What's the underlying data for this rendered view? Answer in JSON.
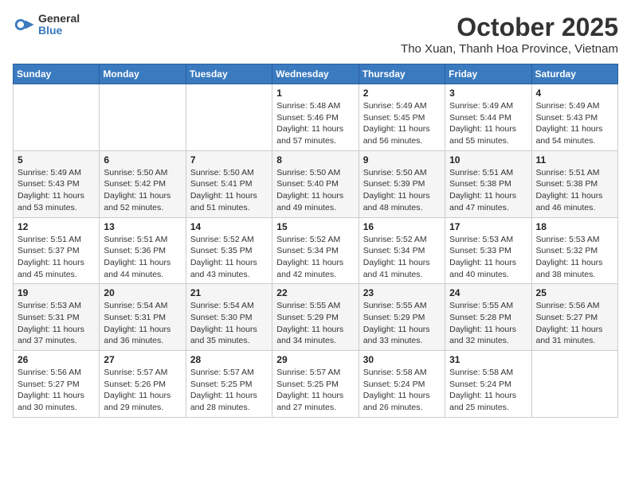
{
  "logo": {
    "general": "General",
    "blue": "Blue"
  },
  "title": "October 2025",
  "location": "Tho Xuan, Thanh Hoa Province, Vietnam",
  "weekdays": [
    "Sunday",
    "Monday",
    "Tuesday",
    "Wednesday",
    "Thursday",
    "Friday",
    "Saturday"
  ],
  "weeks": [
    [
      {
        "day": "",
        "info": ""
      },
      {
        "day": "",
        "info": ""
      },
      {
        "day": "",
        "info": ""
      },
      {
        "day": "1",
        "info": "Sunrise: 5:48 AM\nSunset: 5:46 PM\nDaylight: 11 hours and 57 minutes."
      },
      {
        "day": "2",
        "info": "Sunrise: 5:49 AM\nSunset: 5:45 PM\nDaylight: 11 hours and 56 minutes."
      },
      {
        "day": "3",
        "info": "Sunrise: 5:49 AM\nSunset: 5:44 PM\nDaylight: 11 hours and 55 minutes."
      },
      {
        "day": "4",
        "info": "Sunrise: 5:49 AM\nSunset: 5:43 PM\nDaylight: 11 hours and 54 minutes."
      }
    ],
    [
      {
        "day": "5",
        "info": "Sunrise: 5:49 AM\nSunset: 5:43 PM\nDaylight: 11 hours and 53 minutes."
      },
      {
        "day": "6",
        "info": "Sunrise: 5:50 AM\nSunset: 5:42 PM\nDaylight: 11 hours and 52 minutes."
      },
      {
        "day": "7",
        "info": "Sunrise: 5:50 AM\nSunset: 5:41 PM\nDaylight: 11 hours and 51 minutes."
      },
      {
        "day": "8",
        "info": "Sunrise: 5:50 AM\nSunset: 5:40 PM\nDaylight: 11 hours and 49 minutes."
      },
      {
        "day": "9",
        "info": "Sunrise: 5:50 AM\nSunset: 5:39 PM\nDaylight: 11 hours and 48 minutes."
      },
      {
        "day": "10",
        "info": "Sunrise: 5:51 AM\nSunset: 5:38 PM\nDaylight: 11 hours and 47 minutes."
      },
      {
        "day": "11",
        "info": "Sunrise: 5:51 AM\nSunset: 5:38 PM\nDaylight: 11 hours and 46 minutes."
      }
    ],
    [
      {
        "day": "12",
        "info": "Sunrise: 5:51 AM\nSunset: 5:37 PM\nDaylight: 11 hours and 45 minutes."
      },
      {
        "day": "13",
        "info": "Sunrise: 5:51 AM\nSunset: 5:36 PM\nDaylight: 11 hours and 44 minutes."
      },
      {
        "day": "14",
        "info": "Sunrise: 5:52 AM\nSunset: 5:35 PM\nDaylight: 11 hours and 43 minutes."
      },
      {
        "day": "15",
        "info": "Sunrise: 5:52 AM\nSunset: 5:34 PM\nDaylight: 11 hours and 42 minutes."
      },
      {
        "day": "16",
        "info": "Sunrise: 5:52 AM\nSunset: 5:34 PM\nDaylight: 11 hours and 41 minutes."
      },
      {
        "day": "17",
        "info": "Sunrise: 5:53 AM\nSunset: 5:33 PM\nDaylight: 11 hours and 40 minutes."
      },
      {
        "day": "18",
        "info": "Sunrise: 5:53 AM\nSunset: 5:32 PM\nDaylight: 11 hours and 38 minutes."
      }
    ],
    [
      {
        "day": "19",
        "info": "Sunrise: 5:53 AM\nSunset: 5:31 PM\nDaylight: 11 hours and 37 minutes."
      },
      {
        "day": "20",
        "info": "Sunrise: 5:54 AM\nSunset: 5:31 PM\nDaylight: 11 hours and 36 minutes."
      },
      {
        "day": "21",
        "info": "Sunrise: 5:54 AM\nSunset: 5:30 PM\nDaylight: 11 hours and 35 minutes."
      },
      {
        "day": "22",
        "info": "Sunrise: 5:55 AM\nSunset: 5:29 PM\nDaylight: 11 hours and 34 minutes."
      },
      {
        "day": "23",
        "info": "Sunrise: 5:55 AM\nSunset: 5:29 PM\nDaylight: 11 hours and 33 minutes."
      },
      {
        "day": "24",
        "info": "Sunrise: 5:55 AM\nSunset: 5:28 PM\nDaylight: 11 hours and 32 minutes."
      },
      {
        "day": "25",
        "info": "Sunrise: 5:56 AM\nSunset: 5:27 PM\nDaylight: 11 hours and 31 minutes."
      }
    ],
    [
      {
        "day": "26",
        "info": "Sunrise: 5:56 AM\nSunset: 5:27 PM\nDaylight: 11 hours and 30 minutes."
      },
      {
        "day": "27",
        "info": "Sunrise: 5:57 AM\nSunset: 5:26 PM\nDaylight: 11 hours and 29 minutes."
      },
      {
        "day": "28",
        "info": "Sunrise: 5:57 AM\nSunset: 5:25 PM\nDaylight: 11 hours and 28 minutes."
      },
      {
        "day": "29",
        "info": "Sunrise: 5:57 AM\nSunset: 5:25 PM\nDaylight: 11 hours and 27 minutes."
      },
      {
        "day": "30",
        "info": "Sunrise: 5:58 AM\nSunset: 5:24 PM\nDaylight: 11 hours and 26 minutes."
      },
      {
        "day": "31",
        "info": "Sunrise: 5:58 AM\nSunset: 5:24 PM\nDaylight: 11 hours and 25 minutes."
      },
      {
        "day": "",
        "info": ""
      }
    ]
  ]
}
